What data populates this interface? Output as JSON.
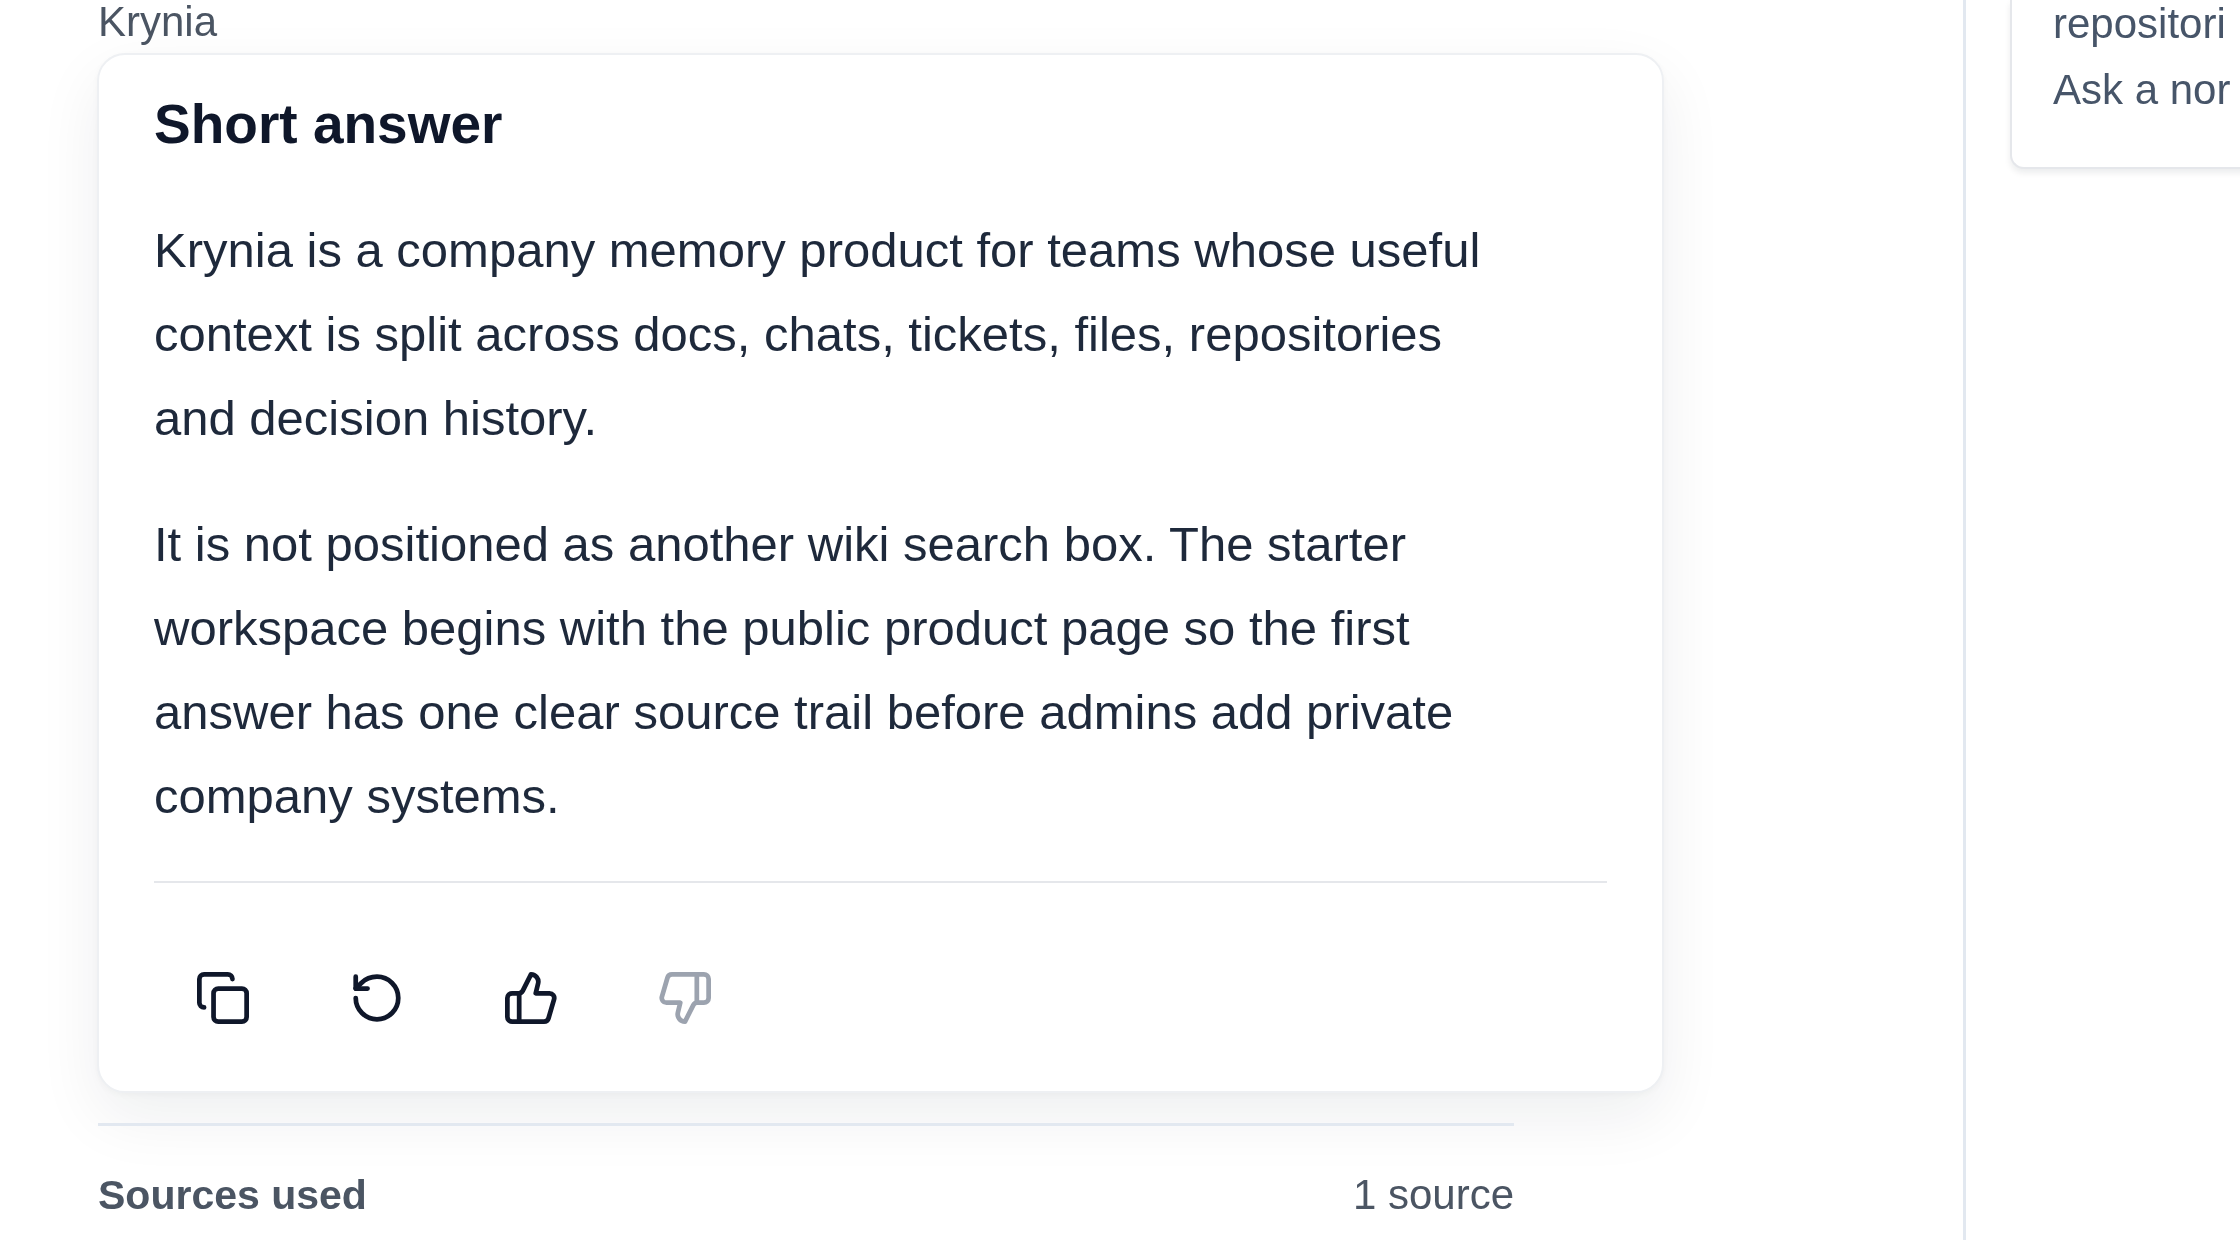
{
  "sender": "Krynia",
  "answer_card": {
    "title": "Short answer",
    "paragraphs": [
      "Krynia is a company memory product for teams whose useful context is split across docs, chats, tickets, files, repositories and decision history.",
      "It is not positioned as another wiki search box. The starter workspace begins with the public product page so the first answer has one clear source trail before admins add private company systems."
    ],
    "actions": [
      {
        "kind": "copy",
        "disabled": false
      },
      {
        "kind": "retry",
        "disabled": false
      },
      {
        "kind": "like",
        "disabled": false
      },
      {
        "kind": "dislike",
        "disabled": true
      }
    ]
  },
  "sources": {
    "label": "Sources used",
    "count": "1 source"
  },
  "side_panel": {
    "lines": [
      "repositori",
      "Ask a nor"
    ]
  }
}
